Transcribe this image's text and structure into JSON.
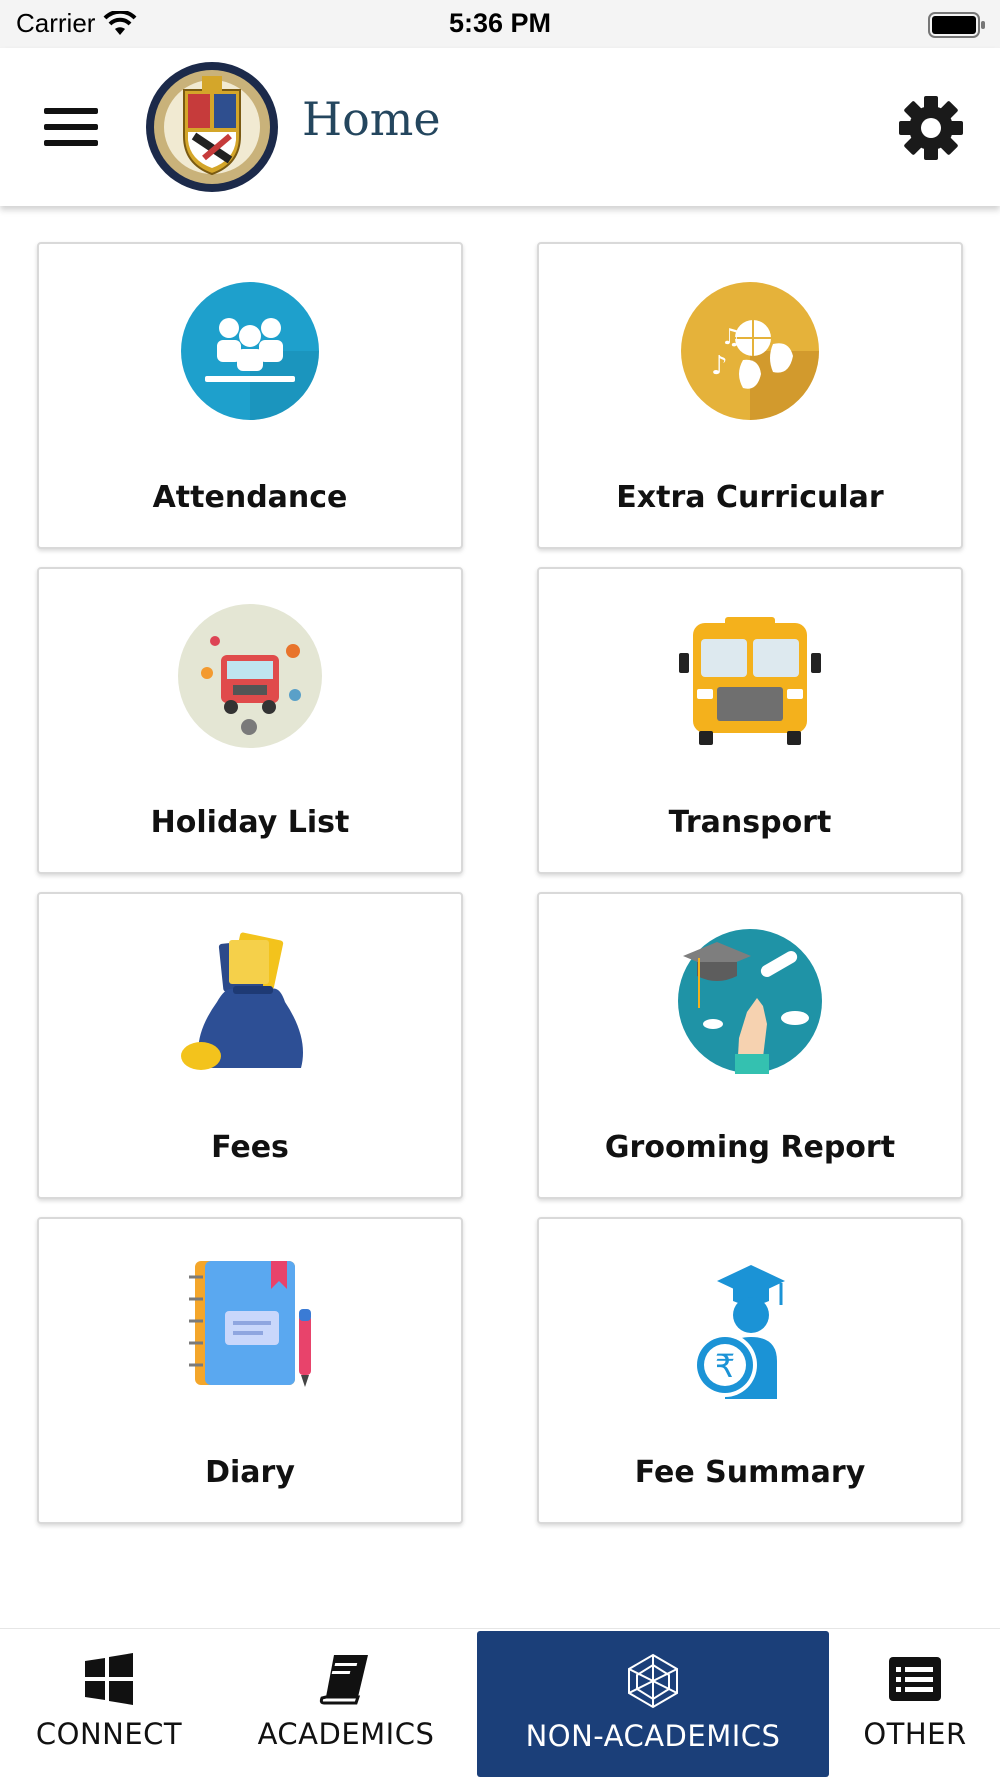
{
  "status_bar": {
    "carrier": "Carrier",
    "time": "5:36 PM"
  },
  "header": {
    "title": "Home",
    "logo_icon": "school-crest-logo",
    "menu_icon": "hamburger-menu-icon",
    "settings_icon": "gear-icon"
  },
  "tiles": [
    {
      "label": "Attendance",
      "icon": "attendance-icon"
    },
    {
      "label": "Extra Curricular",
      "icon": "extra-curricular-icon"
    },
    {
      "label": "Holiday List",
      "icon": "holiday-list-icon"
    },
    {
      "label": "Transport",
      "icon": "school-bus-icon"
    },
    {
      "label": "Fees",
      "icon": "money-bag-icon"
    },
    {
      "label": "Grooming Report",
      "icon": "graduation-icon"
    },
    {
      "label": "Diary",
      "icon": "notebook-icon"
    },
    {
      "label": "Fee Summary",
      "icon": "student-rupee-icon"
    }
  ],
  "tabbar": {
    "tabs": [
      {
        "label": "CONNECT",
        "icon": "windows-icon"
      },
      {
        "label": "ACADEMICS",
        "icon": "book-icon"
      },
      {
        "label": "NON-ACADEMICS",
        "icon": "polyhedron-icon",
        "active": true
      },
      {
        "label": "OTHER",
        "icon": "list-icon"
      }
    ]
  },
  "colors": {
    "active_tab": "#1b3f79",
    "title": "#24465e"
  }
}
